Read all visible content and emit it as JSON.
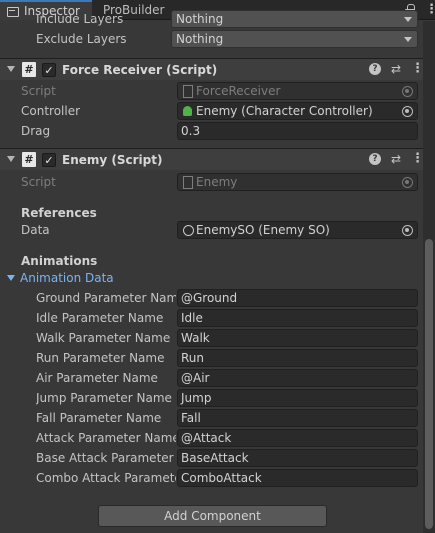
{
  "tabs": [
    {
      "label": "Inspector"
    },
    {
      "label": "ProBuilder"
    }
  ],
  "tabbar_icons": [
    "lock-icon",
    "kebab-menu-icon"
  ],
  "top_fields": [
    {
      "label": "Include Layers",
      "value": "Nothing"
    },
    {
      "label": "Exclude Layers",
      "value": "Nothing"
    }
  ],
  "force_receiver": {
    "title": "Force Receiver (Script)",
    "script_label": "Script",
    "script_value": "ForceReceiver",
    "controller_label": "Controller",
    "controller_value": "Enemy (Character Controller)",
    "drag_label": "Drag",
    "drag_value": "0.3"
  },
  "enemy": {
    "title": "Enemy (Script)",
    "script_label": "Script",
    "script_value": "Enemy",
    "references_header": "References",
    "data_label": "Data",
    "data_value": "EnemySO (Enemy SO)",
    "animations_header": "Animations",
    "animation_data_label": "Animation Data",
    "params": [
      {
        "label": "Ground Parameter Name",
        "value": "@Ground"
      },
      {
        "label": "Idle Parameter Name",
        "value": "Idle"
      },
      {
        "label": "Walk Parameter Name",
        "value": "Walk"
      },
      {
        "label": "Run Parameter Name",
        "value": "Run"
      },
      {
        "label": "Air Parameter Name",
        "value": "@Air"
      },
      {
        "label": "Jump Parameter Name",
        "value": "Jump"
      },
      {
        "label": "Fall Parameter Name",
        "value": "Fall"
      },
      {
        "label": "Attack Parameter Name",
        "value": "@Attack"
      },
      {
        "label": "Base Attack Parameter Name",
        "value": "BaseAttack"
      },
      {
        "label": "Combo Attack Parameter Name",
        "value": "ComboAttack"
      }
    ]
  },
  "add_component_label": "Add Component",
  "colors": {
    "panel_bg": "#383838",
    "header_bg": "#3e3e3e",
    "field_bg": "#2a2a2a",
    "foldout_blue": "#7bb3f0",
    "tab_accent": "#3a79bb"
  }
}
